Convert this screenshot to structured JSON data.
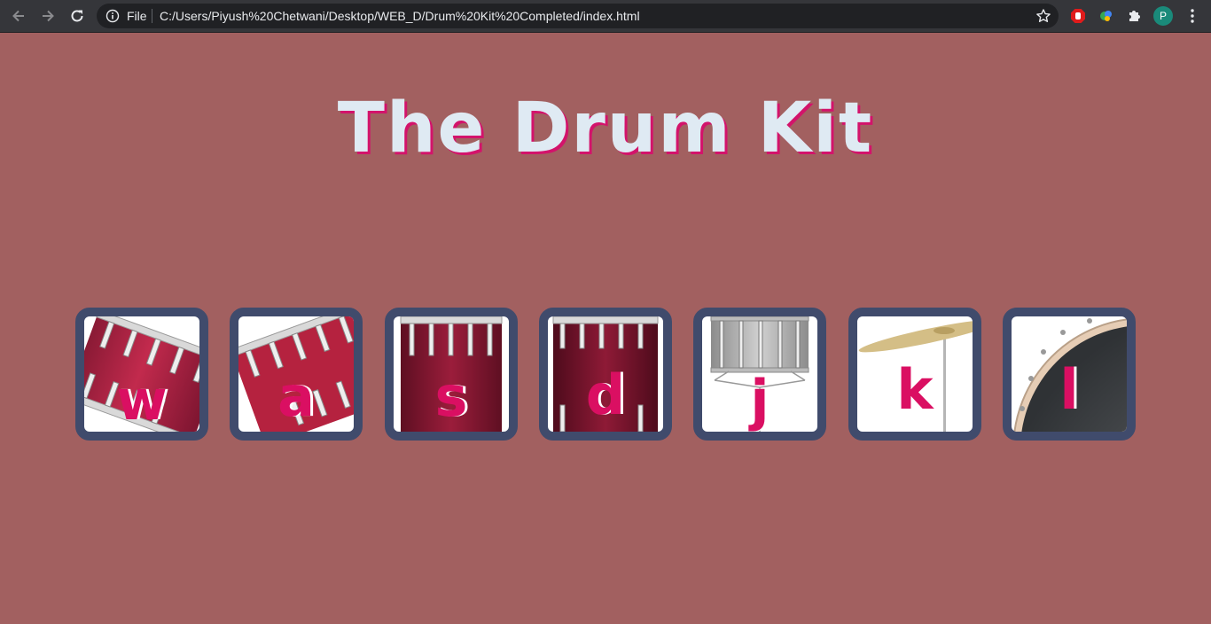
{
  "browser": {
    "file_label": "File",
    "url": "C:/Users/Piyush%20Chetwani/Desktop/WEB_D/Drum%20Kit%20Completed/index.html",
    "profile_initial": "P"
  },
  "page": {
    "title": "The Drum Kit"
  },
  "drums": [
    {
      "key": "w",
      "icon": "tom1-icon"
    },
    {
      "key": "a",
      "icon": "tom2-icon"
    },
    {
      "key": "s",
      "icon": "tom3-icon"
    },
    {
      "key": "d",
      "icon": "tom4-icon"
    },
    {
      "key": "j",
      "icon": "snare-icon"
    },
    {
      "key": "k",
      "icon": "crash-icon"
    },
    {
      "key": "l",
      "icon": "kick-icon"
    }
  ],
  "colors": {
    "background": "#a26060",
    "title": "#dfeaf3",
    "title_shadow": "#d3136b",
    "drum_border": "#404b6c",
    "key_letter": "#da0f62"
  }
}
